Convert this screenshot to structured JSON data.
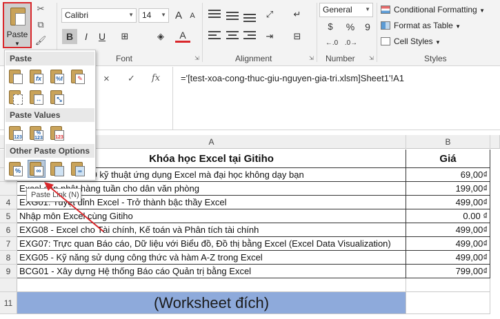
{
  "ribbon": {
    "clipboard": {
      "paste_label": "Paste"
    },
    "font": {
      "name": "Calibri",
      "size": "14",
      "group_label": "Font",
      "bold": "B",
      "italic": "I",
      "underline": "U",
      "font_color_glyph": "A",
      "grow": "A",
      "shrink": "A"
    },
    "alignment": {
      "group_label": "Alignment"
    },
    "number": {
      "format": "General",
      "group_label": "Number",
      "currency": "$",
      "percent": "%",
      "comma": "9"
    },
    "styles": {
      "group_label": "Styles",
      "conditional": "Conditional Formatting",
      "format_table": "Format as Table",
      "cell_styles": "Cell Styles"
    }
  },
  "formula_bar": {
    "cancel": "×",
    "confirm": "✓",
    "fx": "fx",
    "formula": "='[test-xoa-cong-thuc-giu-nguyen-gia-tri.xlsm]Sheet1'!A1"
  },
  "grid": {
    "columns": [
      "A",
      "B"
    ],
    "rows": [
      {
        "num": "",
        "a": "Khóa học Excel tại Gitiho",
        "b": "Giá"
      },
      {
        "num": "",
        "a": "Excel - Khai phá 10 kỹ thuật ứng dụng Excel mà đại học không dạy bạn",
        "b": "69,00₫"
      },
      {
        "num": "",
        "a": "Excel cập nhật hàng tuần cho dân văn phòng",
        "b": "199,00₫"
      },
      {
        "num": "4",
        "a": "EXG01: Tuyệt đỉnh Excel - Trở thành bậc thầy Excel",
        "b": "499,00₫"
      },
      {
        "num": "5",
        "a": "Nhập môn Excel cùng Gitiho",
        "b": "0.00 ₫"
      },
      {
        "num": "6",
        "a": "EXG08 - Excel cho Tài chính, Kế toán và Phân tích tài chính",
        "b": "499,00₫"
      },
      {
        "num": "7",
        "a": "EXG07: Trực quan Báo cáo, Dữ liệu với Biểu đồ, Đồ thị bằng Excel (Excel Data Visualization)",
        "b": "499,00₫"
      },
      {
        "num": "8",
        "a": "EXG05 - Kỹ năng sử dụng công thức và hàm A-Z trong Excel",
        "b": "499,00₫"
      },
      {
        "num": "9",
        "a": "BCG01 - Xây dựng Hệ thống Báo cáo Quản trị bằng Excel",
        "b": "799,00₫"
      },
      {
        "num": "",
        "a": "",
        "b": ""
      },
      {
        "num": "11",
        "a": "(Worksheet đích)",
        "b": ""
      }
    ]
  },
  "paste_menu": {
    "section_paste": "Paste",
    "section_values": "Paste Values",
    "section_other": "Other Paste Options",
    "tooltip": "Paste Link (N)",
    "value_badge": "123",
    "percent_badge": "%"
  },
  "colors": {
    "highlight_red": "#d9262a",
    "worksheet_band": "#8eaadb",
    "selected_option": "#b9c9da"
  }
}
